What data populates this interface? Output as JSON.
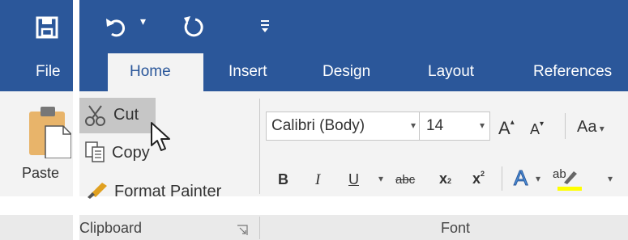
{
  "qat": {
    "save_icon": "save-icon",
    "undo_icon": "undo-icon",
    "redo_icon": "redo-icon",
    "customize_icon": "customize-qat-icon"
  },
  "tabs": {
    "file": "File",
    "home": "Home",
    "insert": "Insert",
    "design": "Design",
    "layout": "Layout",
    "references": "References"
  },
  "clipboard": {
    "paste": "Paste",
    "cut": "Cut",
    "copy": "Copy",
    "format_painter": "Format Painter",
    "group_label": "Clipboard"
  },
  "font": {
    "font_name": "Calibri (Body)",
    "font_size": "14",
    "grow": "A",
    "shrink": "A",
    "change_case": "Aa",
    "bold": "B",
    "italic": "I",
    "underline": "U",
    "strike": "abc",
    "subscript": "x",
    "sub_mark": "2",
    "superscript": "x",
    "sup_mark": "2",
    "text_effects": "A",
    "highlight": "ab",
    "group_label": "Font"
  },
  "colors": {
    "ribbon_blue": "#2b579a",
    "ribbon_bg": "#f3f3f3",
    "hover": "#c6c6c6",
    "highlight_yellow": "#ffff00"
  }
}
